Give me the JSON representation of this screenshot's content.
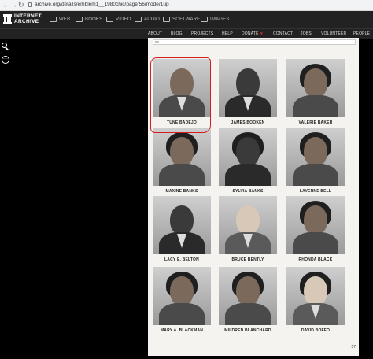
{
  "browser": {
    "back": "←",
    "forward": "→",
    "reload": "↻",
    "url": "archive.org/details/emblem1__1980chic/page/56/mode/1up"
  },
  "header": {
    "logo_line1": "INTERNET",
    "logo_line2": "ARCHIVE",
    "media": [
      {
        "label": "WEB",
        "icon": "web-icon"
      },
      {
        "label": "BOOKS",
        "icon": "books-icon"
      },
      {
        "label": "VIDEO",
        "icon": "video-icon"
      },
      {
        "label": "AUDIO",
        "icon": "audio-icon"
      },
      {
        "label": "SOFTWARE",
        "icon": "software-icon"
      },
      {
        "label": "IMAGES",
        "icon": "images-icon"
      }
    ]
  },
  "subnav": {
    "items": [
      "ABOUT",
      "BLOG",
      "PROJECTS",
      "HELP",
      "DONATE",
      "CONTACT",
      "JOBS",
      "VOLUNTEER",
      "PEOPLE"
    ],
    "donate_heart": "♥"
  },
  "sidebar": {
    "search_icon": "search-icon",
    "more_icon": "more-icon",
    "more_glyph": "···"
  },
  "book": {
    "strip_label": "56",
    "page_number": "57",
    "people": [
      {
        "name": "TUNE BADEJO"
      },
      {
        "name": "JAMES BOOKEN"
      },
      {
        "name": "VALERIE BAKER"
      },
      {
        "name": "MAXINE BANKS"
      },
      {
        "name": "SYLVIA BANKS"
      },
      {
        "name": "LAVERNE BELL"
      },
      {
        "name": "LACY E. BELTON"
      },
      {
        "name": "BRUCE BENTLY"
      },
      {
        "name": "RHONDA BLACK"
      },
      {
        "name": "MARY A. BLACKMAN"
      },
      {
        "name": "MILDRED BLANCHARD"
      },
      {
        "name": "DAVID BOFFO"
      }
    ]
  },
  "colors": {
    "highlight": "#d41c1c",
    "topbar": "#222222"
  }
}
